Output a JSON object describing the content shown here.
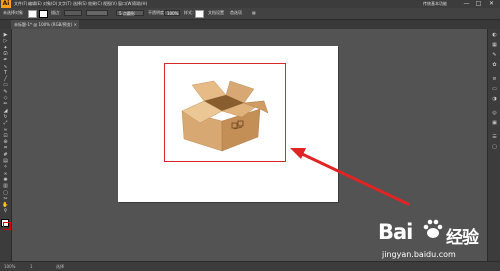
{
  "app": {
    "logo_text": "Ai"
  },
  "menu": {
    "items": [
      "文件(F)",
      "编辑(E)",
      "对象(O)",
      "文字(T)",
      "选择(S)",
      "效果(C)",
      "视图(V)",
      "窗口(W)",
      "帮助(H)"
    ]
  },
  "window_controls": {
    "workspace": "传统基本功能",
    "minimize": "—",
    "maximize": "□",
    "close": "✕"
  },
  "control_bar": {
    "selection_label": "未选择对象",
    "stroke_label": "描边：",
    "stroke_width": "",
    "brush_value": "5 点圆形",
    "opacity_label": "不透明度：",
    "opacity_value": "100%",
    "style_label": "样式：",
    "doc_setup_button": "文档设置",
    "preferences_button": "首选项"
  },
  "document_tab": {
    "title": "未标题-1* @ 100% (RGB/预览)",
    "close": "×"
  },
  "status_bar": {
    "zoom": "100%",
    "page": "1",
    "tool": "选择"
  },
  "tools": [
    "selection-tool",
    "direct-selection-tool",
    "magic-wand-tool",
    "lasso-tool",
    "pen-tool",
    "curvature-tool",
    "type-tool",
    "line-tool",
    "rectangle-tool",
    "paintbrush-tool",
    "shaper-tool",
    "pencil-tool",
    "eraser-tool",
    "rotate-tool",
    "scale-tool",
    "width-tool",
    "free-transform-tool",
    "shape-builder-tool",
    "perspective-grid-tool",
    "mesh-tool",
    "gradient-tool",
    "eyedropper-tool",
    "blend-tool",
    "symbol-sprayer-tool",
    "column-graph-tool",
    "artboard-tool",
    "slice-tool",
    "hand-tool",
    "zoom-tool"
  ],
  "colors": {
    "canvas_bg": "#535353",
    "artboard": "#ffffff",
    "selection_border": "#d72b2b",
    "arrow": "#e02424",
    "box_light": "#dcae7a",
    "box_mid": "#c99561",
    "box_dark": "#a9743f"
  },
  "watermark": {
    "brand": "Bai",
    "brand2": "经验",
    "url": "jingyan.baidu.com"
  }
}
